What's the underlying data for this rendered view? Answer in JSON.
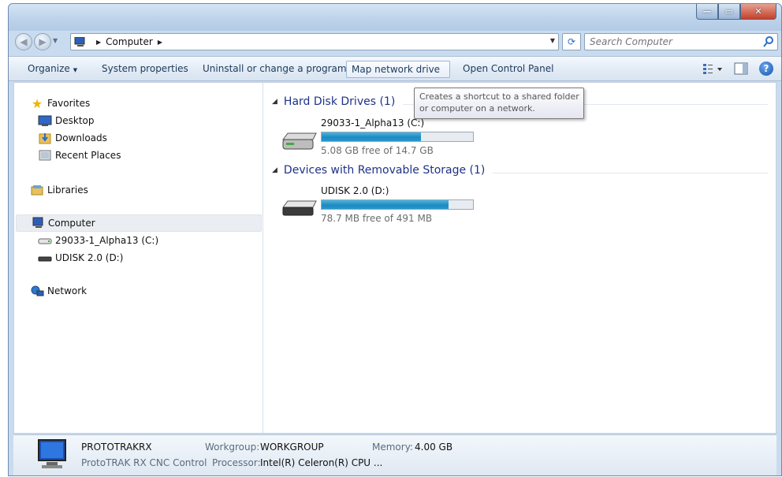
{
  "window": {
    "buttons": {
      "minimize": "—",
      "maximize": "▭",
      "close": "✕"
    }
  },
  "address": {
    "crumbs": [
      "Computer"
    ],
    "search_placeholder": "Search Computer"
  },
  "toolbar": {
    "organize": "Organize",
    "system_properties": "System properties",
    "uninstall": "Uninstall or change a program",
    "map_network_drive": "Map network drive",
    "open_control_panel": "Open Control Panel"
  },
  "tooltip": {
    "line1": "Creates a shortcut to a shared folder",
    "line2": "or computer on a network."
  },
  "sidebar": {
    "favorites": "Favorites",
    "desktop": "Desktop",
    "downloads": "Downloads",
    "recent_places": "Recent Places",
    "libraries": "Libraries",
    "computer": "Computer",
    "drive_c": "29033-1_Alpha13 (C:)",
    "drive_d": "UDISK 2.0 (D:)",
    "network": "Network"
  },
  "groups": {
    "hard_disk": "Hard Disk Drives (1)",
    "removable": "Devices with Removable Storage (1)"
  },
  "drives": [
    {
      "name": "29033-1_Alpha13 (C:)",
      "free_text": "5.08 GB free of 14.7 GB",
      "used_fraction": 0.655
    },
    {
      "name": "UDISK 2.0 (D:)",
      "free_text": "78.7 MB free of 491 MB",
      "used_fraction": 0.84
    }
  ],
  "details": {
    "computer_name": "PROTOTRAKRX",
    "description": "ProtoTRAK RX CNC Control",
    "workgroup_label": "Workgroup:",
    "workgroup_value": "WORKGROUP",
    "memory_label": "Memory:",
    "memory_value": "4.00 GB",
    "processor_label": "Processor:",
    "processor_value": "Intel(R) Celeron(R) CPU ..."
  },
  "colors": {
    "annotation_arrow": "#e00000",
    "group_header": "#1e3287",
    "drive_bar": "#26a0da"
  }
}
